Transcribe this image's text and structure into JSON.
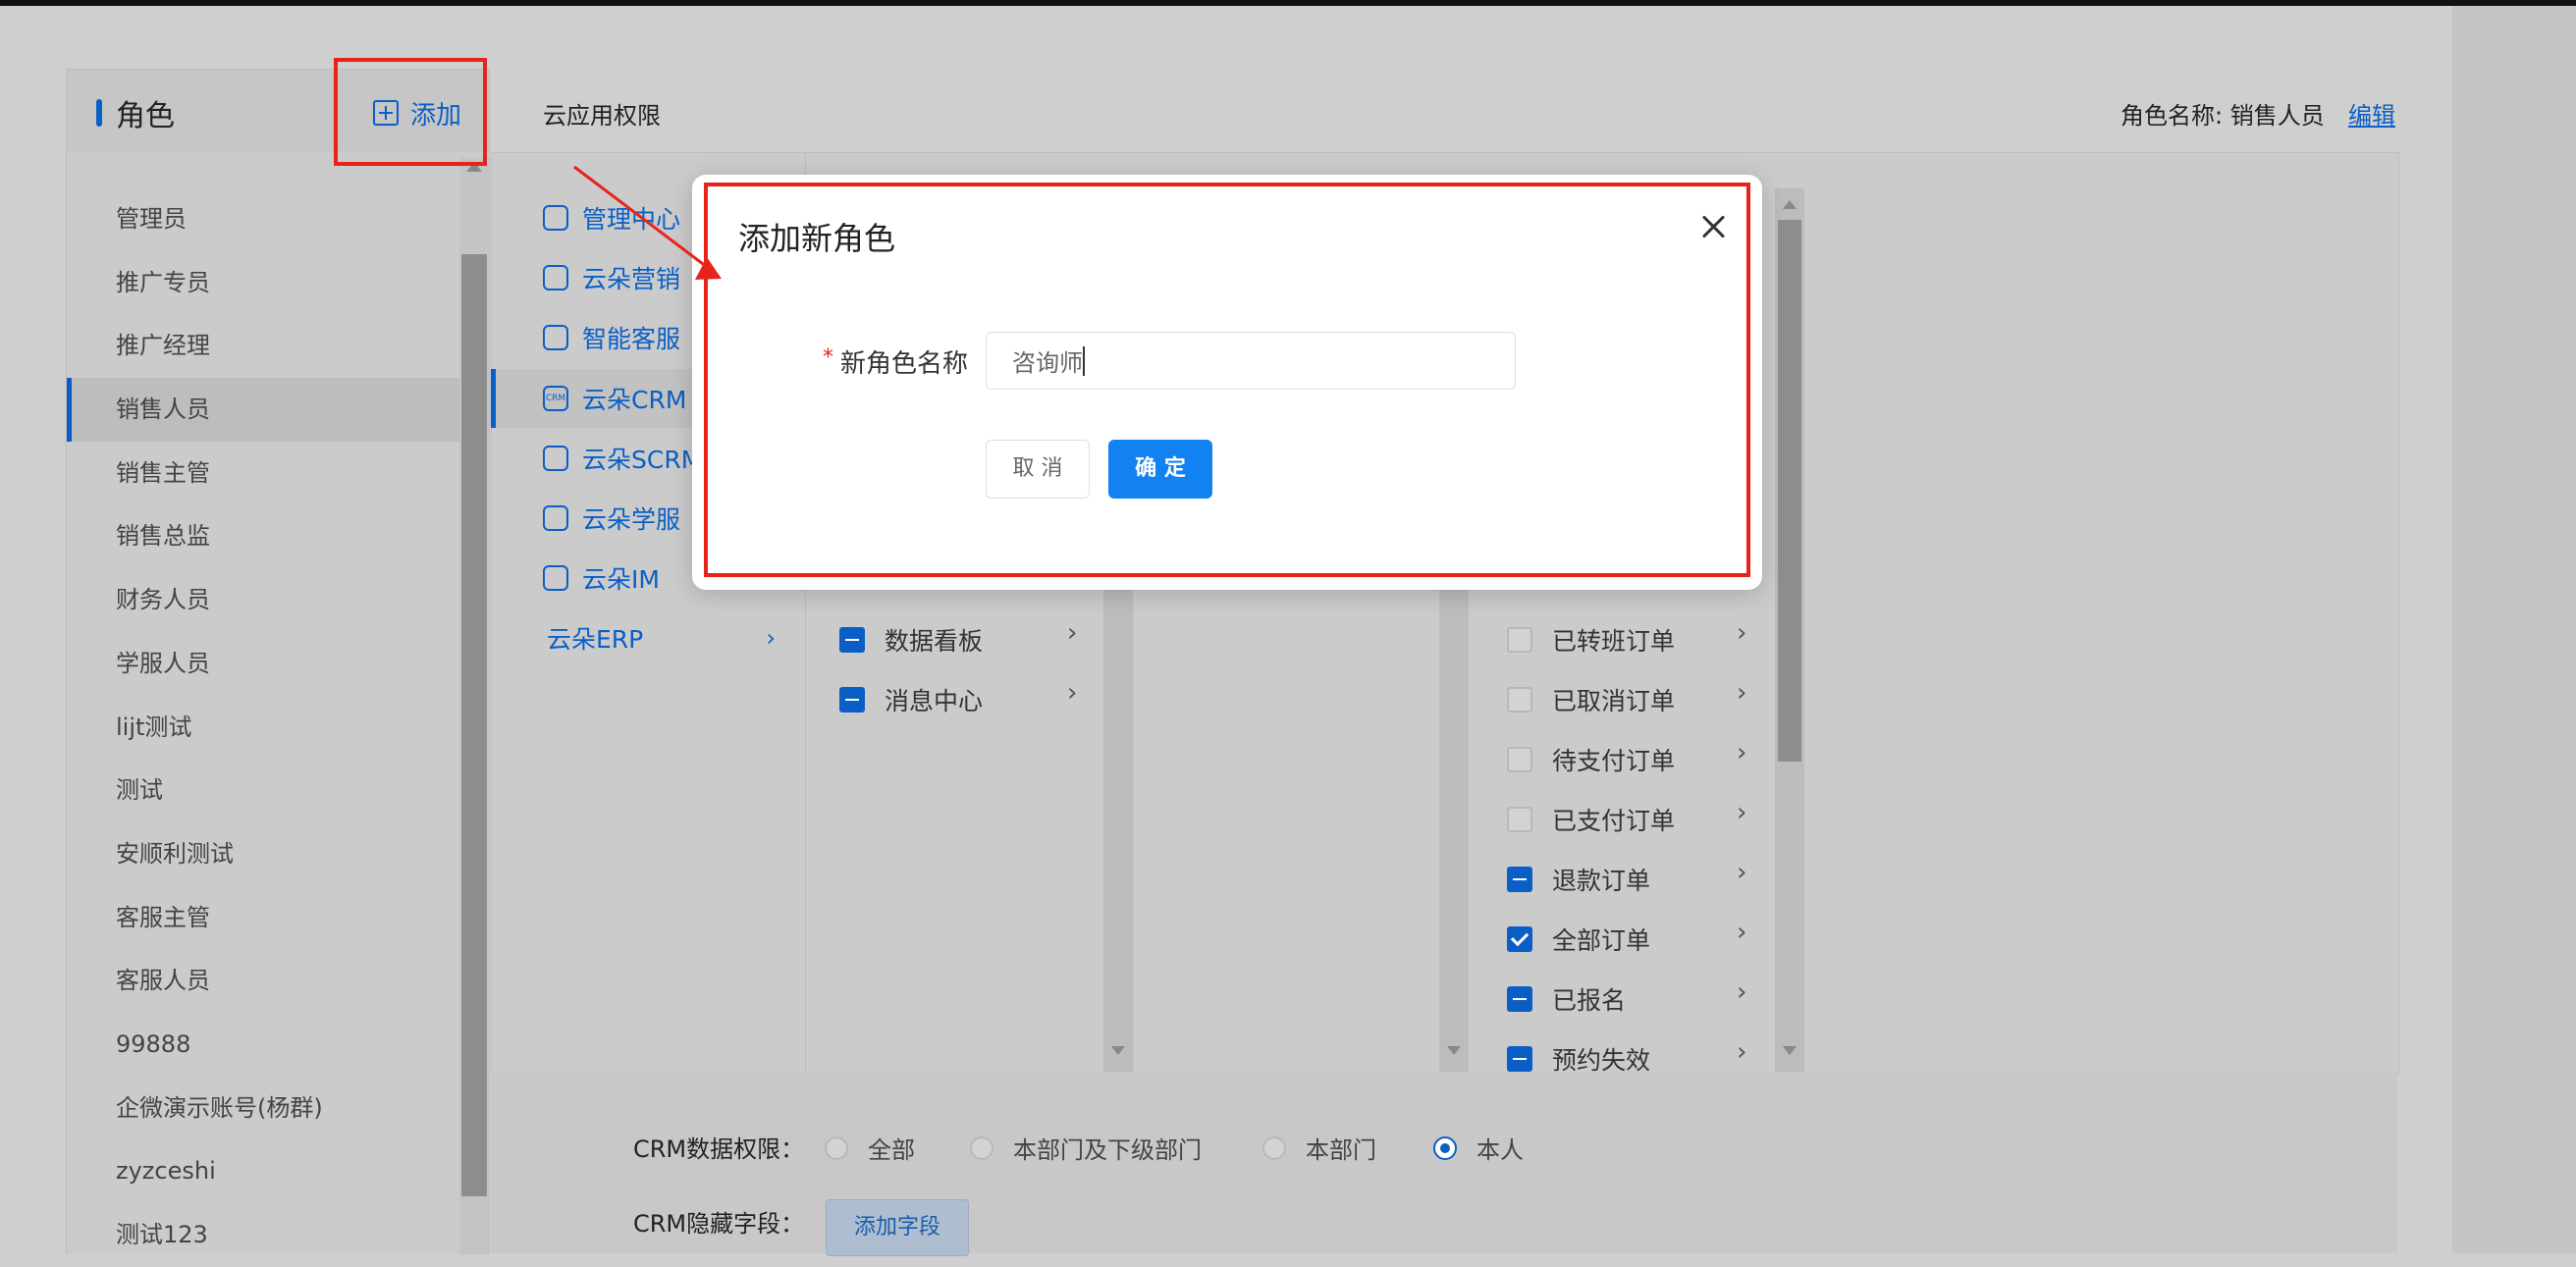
{
  "roles_panel": {
    "title": "角色",
    "add_label": "添加",
    "items": [
      "管理员",
      "推广专员",
      "推广经理",
      "销售人员",
      "销售主管",
      "销售总监",
      "财务人员",
      "学服人员",
      "lijt测试",
      "测试",
      "安顺利测试",
      "客服主管",
      "客服人员",
      "99888",
      "企微演示账号(杨群)",
      "zyzceshi",
      "测试123"
    ],
    "active_item": "销售人员"
  },
  "main": {
    "title": "云应用权限",
    "role_name_label": "角色名称: 销售人员",
    "edit_label": "编辑"
  },
  "apps": [
    {
      "label": "管理中心"
    },
    {
      "label": "云朵营销"
    },
    {
      "label": "智能客服"
    },
    {
      "label": "云朵CRM",
      "active": true
    },
    {
      "label": "云朵SCRM"
    },
    {
      "label": "云朵学服"
    },
    {
      "label": "云朵IM",
      "chevron": "›"
    },
    {
      "label": "云朵ERP",
      "chevron": "›"
    }
  ],
  "modules": [
    {
      "label": "数据看板",
      "state": "partial"
    },
    {
      "label": "消息中心",
      "state": "partial"
    }
  ],
  "sub_permissions": [
    {
      "label": "已转班订单",
      "state": "empty"
    },
    {
      "label": "已取消订单",
      "state": "empty"
    },
    {
      "label": "待支付订单",
      "state": "empty"
    },
    {
      "label": "已支付订单",
      "state": "empty"
    },
    {
      "label": "退款订单",
      "state": "partial"
    },
    {
      "label": "全部订单",
      "state": "checked"
    },
    {
      "label": "已报名",
      "state": "partial"
    },
    {
      "label": "预约失效",
      "state": "partial"
    }
  ],
  "chevron": "›",
  "crm_data_scope": {
    "label": "CRM数据权限：",
    "options": [
      "全部",
      "本部门及下级部门",
      "本部门",
      "本人"
    ],
    "selected": "本人"
  },
  "crm_hidden_fields": {
    "label": "CRM隐藏字段：",
    "button": "添加字段"
  },
  "modal": {
    "title": "添加新角色",
    "required_mark": "*",
    "field_label": "新角色名称",
    "field_value": "咨询师",
    "cancel": "取 消",
    "ok": "确 定"
  },
  "colors": {
    "accent": "#0a5fc6",
    "primary_button": "#1282f0",
    "highlight_red": "#e8231c"
  }
}
